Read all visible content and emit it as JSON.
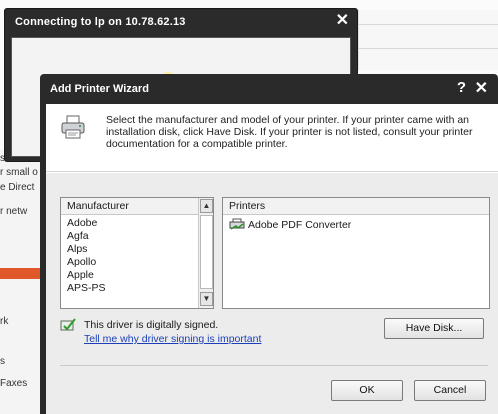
{
  "background": {
    "left_fragments": [
      "s need",
      "r small o",
      "e Direct",
      "r netw",
      "rk",
      "s",
      "Faxes"
    ]
  },
  "connect_window": {
    "title": "Connecting to lp on 10.78.62.13",
    "close_glyph": "✕"
  },
  "wizard": {
    "title": "Add Printer Wizard",
    "help_glyph": "?",
    "close_glyph": "✕",
    "intro": "Select the manufacturer and model of your printer. If your printer came with an installation disk, click Have Disk. If your printer is not listed, consult your printer documentation for a compatible printer.",
    "manufacturer_header": "Manufacturer",
    "manufacturers": [
      "Adobe",
      "Agfa",
      "Alps",
      "Apollo",
      "Apple",
      "APS-PS"
    ],
    "printers_header": "Printers",
    "printers": [
      "Adobe PDF Converter"
    ],
    "signed_text": "This driver is digitally signed.",
    "signing_link": "Tell me why driver signing is important",
    "have_disk_label": "Have Disk...",
    "ok_label": "OK",
    "cancel_label": "Cancel"
  },
  "icons": {
    "printer": "printer-icon",
    "printer_item": "printer-item-icon",
    "signed": "signed-driver-icon",
    "scroll_up": "scroll-up-icon",
    "scroll_down": "scroll-down-icon"
  },
  "colors": {
    "title_bar": "#2a2a2a",
    "link": "#1b3fb8",
    "accent_orange": "#e0582a"
  }
}
